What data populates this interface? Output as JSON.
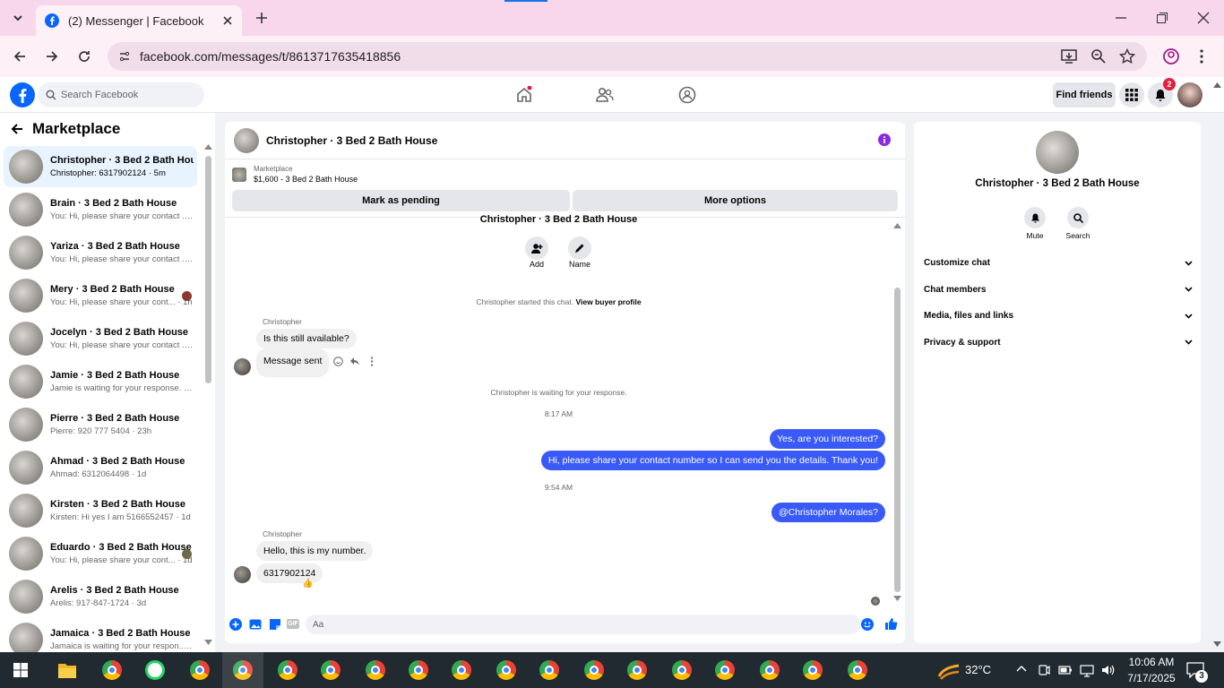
{
  "browser": {
    "tab_title": "(2) Messenger | Facebook",
    "url": "facebook.com/messages/t/8613717635418856"
  },
  "header": {
    "search_placeholder": "Search Facebook",
    "find_friends": "Find friends",
    "notif_count": "2"
  },
  "sidebar": {
    "title": "Marketplace",
    "conversations": [
      {
        "name": "Christopher · 3 Bed 2 Bath House",
        "preview": "Christopher: 6317902124 · 5m",
        "active": true
      },
      {
        "name": "Brain · 3 Bed 2 Bath House",
        "preview": "You: Hi, please share your contact ... · 1h"
      },
      {
        "name": "Yariza · 3 Bed 2 Bath House",
        "preview": "You: Hi, please share your contact ... · 1h"
      },
      {
        "name": "Mery · 3 Bed 2 Bath House",
        "preview": "You: Hi, please share your cont... · 1h"
      },
      {
        "name": "Jocelyn · 3 Bed 2 Bath House",
        "preview": "You: Hi, please share your contact ... · 1h"
      },
      {
        "name": "Jamie · 3 Bed 2 Bath House",
        "preview": "Jamie is waiting for your response. · 3h"
      },
      {
        "name": "Pierre · 3 Bed 2 Bath House",
        "preview": "Pierre: 920 777 5404 · 23h"
      },
      {
        "name": "Ahmad · 3 Bed 2 Bath House",
        "preview": "Ahmad: 6312064498 · 1d"
      },
      {
        "name": "Kirsten · 3 Bed 2 Bath House",
        "preview": "Kirsten: Hi yes I am 5166552457 · 1d"
      },
      {
        "name": "Eduardo · 3 Bed 2 Bath House",
        "preview": "You: Hi, please share your cont... · 1d"
      },
      {
        "name": "Arelis · 3 Bed 2 Bath House",
        "preview": "Arelis: 917-847-1724 · 3d"
      },
      {
        "name": "Jamaica · 3 Bed 2 Bath House",
        "preview": "Jamaica is waiting for your respon... · 3d"
      }
    ]
  },
  "chat": {
    "title": "Christopher · 3 Bed 2 Bath House",
    "listing_label": "Marketplace",
    "listing_price": "$1,600 - 3 Bed 2 Bath House",
    "mark_pending": "Mark as pending",
    "more_options": "More options",
    "top_name": "Christopher · 3 Bed 2 Bath House",
    "add_label": "Add",
    "name_label": "Name",
    "started_text": "Christopher started this chat.",
    "view_profile": "View buyer profile",
    "sender1": "Christopher",
    "msg1": "Is this still available?",
    "msg2": "Message sent",
    "waiting": "Christopher is waiting for your response.",
    "time1": "8:17 AM",
    "out1": "Yes, are you interested?",
    "out2": "Hi, please share your contact number so I can send you the details. Thank you!",
    "time2": "9:54 AM",
    "out3": "@Christopher Morales?",
    "sender2": "Christopher",
    "msg3": "Hello, this is my number.",
    "msg4": "6317902124",
    "reaction": "👍",
    "composer_placeholder": "Aa"
  },
  "info": {
    "name": "Christopher · 3 Bed 2 Bath House",
    "mute": "Mute",
    "search": "Search",
    "items": [
      "Customize chat",
      "Chat members",
      "Media, files and links",
      "Privacy & support"
    ]
  },
  "taskbar": {
    "temp": "32°C",
    "time": "10:06 AM",
    "date": "7/17/2025",
    "notif": "3"
  },
  "colors": {
    "accent": "#0866ff",
    "bubble_out": "#3a5af7",
    "tab_bg": "#f8d7ec"
  }
}
